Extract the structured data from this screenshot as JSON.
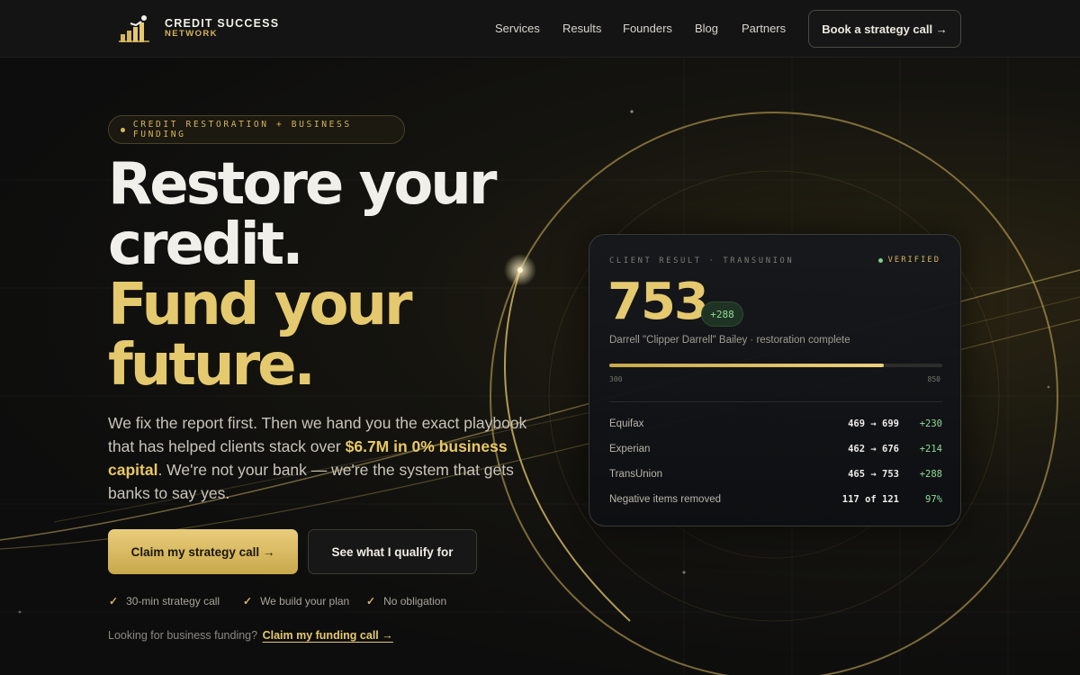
{
  "colors": {
    "accent_gold": "#e5c96e",
    "background": "#0d0d0d",
    "positive_green": "#8fdc98"
  },
  "header": {
    "logo_icon": "rising-bars-runner-icon",
    "brand_name": "CREDIT SUCCESS",
    "brand_sub": "NETWORK",
    "nav": [
      "Services",
      "Results",
      "Founders",
      "Blog",
      "Partners"
    ],
    "cta_label": "Book a strategy call →"
  },
  "hero": {
    "eyebrow": "CREDIT RESTORATION + BUSINESS FUNDING",
    "headline_line1": "Restore your",
    "headline_line2": "credit.",
    "headline_line3": "Fund your",
    "headline_line4": "future.",
    "subcopy_before": "We fix the report first. Then we hand you the exact playbook that has helped clients stack over ",
    "subcopy_highlight": "$6.7M in 0% business capital",
    "subcopy_after": ". We're not your bank — we're the system that gets banks to say yes.",
    "primary_cta": "Claim my strategy call →",
    "secondary_cta": "See what I qualify for",
    "checks": [
      "30-min strategy call",
      "We build your plan",
      "No obligation"
    ],
    "funding_prompt": "Looking for business funding?",
    "funding_link": "Claim my funding call →"
  },
  "card": {
    "label": "CLIENT RESULT · TRANSUNION",
    "verified": "VERIFIED",
    "score": "753",
    "delta": "+288",
    "client_note": "Darrell \"Clipper Darrell\" Bailey · restoration complete",
    "scale_min": "300",
    "scale_max": "850",
    "score_fraction": 0.824,
    "rows": [
      {
        "label": "Equifax",
        "range": "469 → 699",
        "delta": "+230"
      },
      {
        "label": "Experian",
        "range": "462 → 676",
        "delta": "+214"
      },
      {
        "label": "TransUnion",
        "range": "465 → 753",
        "delta": "+288"
      },
      {
        "label": "Negative items removed",
        "range": "117 of 121",
        "delta": "97%"
      }
    ]
  }
}
